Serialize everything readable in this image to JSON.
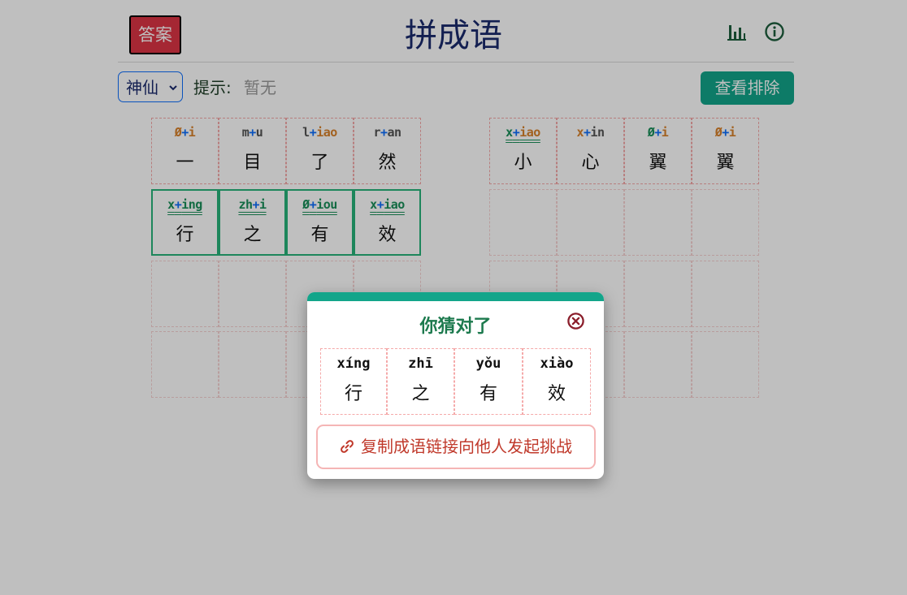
{
  "header": {
    "answer_label": "答案",
    "title": "拼成语",
    "stats_icon": "bar-chart-icon",
    "info_icon": "info-circle-icon"
  },
  "controls": {
    "mode_selected": "神仙",
    "hint_label": "提示:",
    "hint_value": "暂无",
    "view_excluded_label": "查看排除"
  },
  "colors": {
    "green": "#1a8f5a",
    "orange": "#d9822b",
    "gray": "#555555",
    "plus": "#0d6efd",
    "accent": "#12a58a",
    "answer_red": "#dc3545"
  },
  "left_board": {
    "row1": [
      {
        "ini": "Ø",
        "fin": "i",
        "ini_color": "orange",
        "fin_color": "orange",
        "hanzi": "一"
      },
      {
        "ini": "m",
        "fin": "u",
        "ini_color": "gray",
        "fin_color": "gray",
        "hanzi": "目"
      },
      {
        "ini": "l",
        "fin": "iao",
        "ini_color": "gray",
        "fin_color": "orange",
        "hanzi": "了"
      },
      {
        "ini": "r",
        "fin": "an",
        "ini_color": "gray",
        "fin_color": "gray",
        "hanzi": "然"
      }
    ],
    "row2": [
      {
        "ini": "x",
        "fin": "ing",
        "ini_color": "green",
        "fin_color": "green",
        "hanzi": "行"
      },
      {
        "ini": "zh",
        "fin": "i",
        "ini_color": "green",
        "fin_color": "green",
        "hanzi": "之"
      },
      {
        "ini": "Ø",
        "fin": "iou",
        "ini_color": "green",
        "fin_color": "green",
        "hanzi": "有"
      },
      {
        "ini": "x",
        "fin": "iao",
        "ini_color": "green",
        "fin_color": "green",
        "hanzi": "效"
      }
    ]
  },
  "right_board": {
    "row1": [
      {
        "ini": "x",
        "fin": "iao",
        "ini_color": "green",
        "fin_color": "orange",
        "hanzi": "小"
      },
      {
        "ini": "x",
        "fin": "in",
        "ini_color": "orange",
        "fin_color": "gray",
        "hanzi": "心"
      },
      {
        "ini": "Ø",
        "fin": "i",
        "ini_color": "green",
        "fin_color": "orange",
        "hanzi": "翼"
      },
      {
        "ini": "Ø",
        "fin": "i",
        "ini_color": "orange",
        "fin_color": "orange",
        "hanzi": "翼"
      }
    ]
  },
  "modal": {
    "title": "你猜对了",
    "result": [
      {
        "pinyin": "xíng",
        "hanzi": "行"
      },
      {
        "pinyin": "zhī",
        "hanzi": "之"
      },
      {
        "pinyin": "yǒu",
        "hanzi": "有"
      },
      {
        "pinyin": "xiào",
        "hanzi": "效"
      }
    ],
    "share_label": "复制成语链接向他人发起挑战"
  }
}
